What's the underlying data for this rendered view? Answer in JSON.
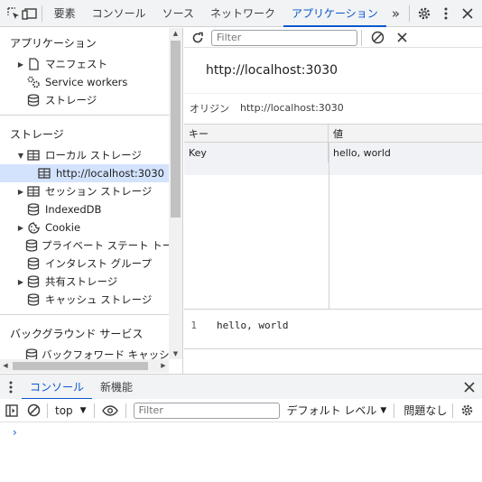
{
  "topbar": {
    "tabs": [
      {
        "label": "要素",
        "active": false
      },
      {
        "label": "コンソール",
        "active": false
      },
      {
        "label": "ソース",
        "active": false
      },
      {
        "label": "ネットワーク",
        "active": false
      },
      {
        "label": "アプリケーション",
        "active": true
      }
    ],
    "more": "»",
    "icons": [
      "inspect-element-icon",
      "device-toolbar-icon",
      "more-tabs-icon",
      "settings-gear-icon",
      "kebab-menu-icon",
      "close-icon"
    ]
  },
  "sidebar": {
    "sections": [
      {
        "heading": "アプリケーション",
        "items": [
          {
            "label": "マニフェスト",
            "icon": "document-icon",
            "arrow": "▶"
          },
          {
            "label": "Service workers",
            "icon": "gears-icon",
            "arrow": ""
          },
          {
            "label": "ストレージ",
            "icon": "database-icon",
            "arrow": ""
          }
        ]
      },
      {
        "heading": "ストレージ",
        "items": [
          {
            "label": "ローカル ストレージ",
            "icon": "table-icon",
            "arrow": "▼"
          },
          {
            "label": "http://localhost:3030",
            "icon": "table-icon",
            "arrow": "",
            "selected": true
          },
          {
            "label": "セッション ストレージ",
            "icon": "table-icon",
            "arrow": "▶"
          },
          {
            "label": "IndexedDB",
            "icon": "database-icon",
            "arrow": ""
          },
          {
            "label": "Cookie",
            "icon": "cookie-icon",
            "arrow": "▶"
          },
          {
            "label": "プライベート ステート トークン",
            "icon": "database-icon",
            "arrow": ""
          },
          {
            "label": "インタレスト グループ",
            "icon": "database-icon",
            "arrow": ""
          },
          {
            "label": "共有ストレージ",
            "icon": "database-icon",
            "arrow": "▶"
          },
          {
            "label": "キャッシュ ストレージ",
            "icon": "database-icon",
            "arrow": ""
          }
        ]
      },
      {
        "heading": "バックグラウンド サービス",
        "items": [
          {
            "label": "バックフォワード キャッシュ",
            "icon": "database-icon",
            "arrow": ""
          }
        ]
      }
    ]
  },
  "main": {
    "filter_placeholder": "Filter",
    "origin_title": "http://localhost:3030",
    "origin_label": "オリジン",
    "origin_value": "http://localhost:3030",
    "columns": {
      "key": "キー",
      "value": "値"
    },
    "rows": [
      {
        "key": "Key",
        "value": "hello, world"
      }
    ],
    "preview": {
      "line_number": "1",
      "text": "hello, world"
    }
  },
  "drawer": {
    "tabs": [
      {
        "label": "コンソール",
        "active": true
      },
      {
        "label": "新機能",
        "active": false
      }
    ],
    "context": "top",
    "filter_placeholder": "Filter",
    "log_level": "デフォルト レベル",
    "issues": "問題なし",
    "prompt": "›"
  },
  "colors": {
    "accent": "#0b57d0",
    "selected_bg": "#d3e3fd",
    "toolbar_bg": "#f1f3f4"
  }
}
